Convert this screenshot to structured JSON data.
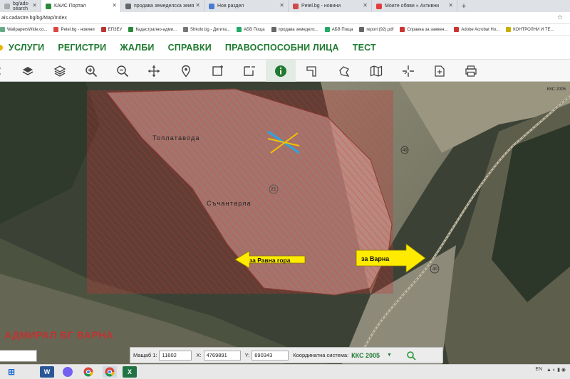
{
  "browser": {
    "tabs": [
      {
        "label": "bg/ads-search",
        "active": false
      },
      {
        "label": "КАИС Портал",
        "active": true
      },
      {
        "label": "продава земеделска земя",
        "active": false
      },
      {
        "label": "Нов раздел",
        "active": false
      },
      {
        "label": "Petel.bg - новини",
        "active": false
      },
      {
        "label": "Моите обяви » Активни",
        "active": false
      }
    ],
    "url": "ais.cadastre.bg/bg/Map/Index",
    "bookmarks": [
      "WallpapersWide.co...",
      "Petel.bg - новини",
      "ЕПЗЕУ",
      "Кадастрално-адми...",
      "Shkolo.bg - Дигита...",
      "АБВ Поща",
      "продава земеделс...",
      "АБВ Поща",
      "report (92).pdf",
      "Справка за заявен...",
      "Adobe Acrobat Ho...",
      "КОНТРОЛНИ И ТЕ..."
    ]
  },
  "menu": [
    "УСЛУГИ",
    "РЕГИСТРИ",
    "ЖАЛБИ",
    "СПРАВКИ",
    "ПРАВОСПОСОБНИ ЛИЦА",
    "ТЕСТ"
  ],
  "toolbar": [
    "layers-icon",
    "layers-outline-icon",
    "zoom-in-icon",
    "zoom-out-icon",
    "pan-icon",
    "location-pin-icon",
    "select-area-icon",
    "deselect-area-icon",
    "info-icon",
    "measure-length-icon",
    "measure-area-icon",
    "map-icon",
    "crosshair-icon",
    "export-icon",
    "print-icon"
  ],
  "map": {
    "place_names": [
      "Топлатавода",
      "Съчантарла"
    ],
    "parcel_labels": [
      "21",
      "49",
      "40"
    ],
    "arrows": [
      {
        "label": "за Равна гора",
        "direction": "left"
      },
      {
        "label": "за Варна",
        "direction": "right"
      }
    ],
    "corner_label": "ККС 2005",
    "watermark": "АДМИРАЛ БГ ВАРНА"
  },
  "scalebar": {
    "scale_label": "Мащаб 1:",
    "scale_value": "11602",
    "x_label": "X:",
    "x_value": "4769891",
    "y_label": "Y:",
    "y_value": "690343",
    "system_label": "Координатна система:",
    "system_value": "ККС 2005"
  },
  "taskbar": {
    "apps": [
      "windows-icon",
      "word-icon",
      "viber-icon",
      "chrome-icon",
      "chrome-icon",
      "excel-icon"
    ],
    "tray": [
      "EN",
      "EN"
    ]
  },
  "colors": {
    "menu_green": "#1f7a30",
    "parcel_red": "#c83232",
    "arrow_yellow": "#ffeb00"
  }
}
